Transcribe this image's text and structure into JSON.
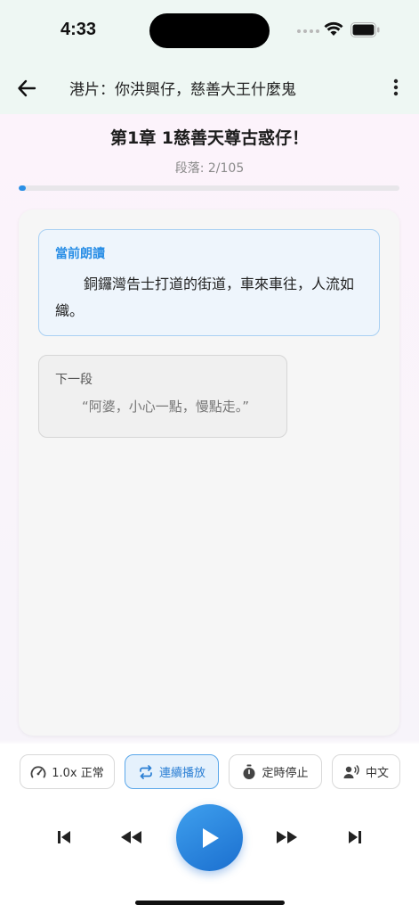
{
  "status_bar": {
    "time": "4:33"
  },
  "app_bar": {
    "title": "港片：你洪興仔，慈善大王什麼鬼"
  },
  "chapter": {
    "title": "第1章 1慈善天尊古惑仔！",
    "paragraph_counter": "段落: 2/105",
    "progress_fraction": 0.019
  },
  "reader": {
    "current_label": "當前朗讀",
    "current_text": "銅鑼灣告士打道的街道，車來車往，人流如織。",
    "next_label": "下一段",
    "next_text": "“阿婆，小心一點，慢點走。”"
  },
  "controls": {
    "speed_label": "1.0x 正常",
    "continuous_label": "連續播放",
    "timer_label": "定時停止",
    "language_label": "中文"
  },
  "colors": {
    "accent": "#2b8fe6",
    "current_border": "#a9d0f3"
  }
}
